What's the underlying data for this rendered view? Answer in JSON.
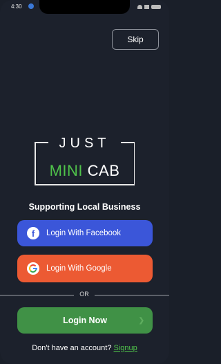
{
  "status": {
    "time": "4:30"
  },
  "header": {
    "skip_label": "Skip"
  },
  "logo": {
    "top": "JUST",
    "mini": "MINI",
    "cab": "CAB"
  },
  "tagline": "Supporting Local Business",
  "auth": {
    "facebook_label": "Login With Facebook",
    "google_label": "Login With Google",
    "or_label": "OR",
    "login_label": "Login Now"
  },
  "footer": {
    "prompt": "Don't have an account?",
    "signup_label": "Signup"
  },
  "icons": {
    "facebook": "facebook-icon",
    "google": "google-icon",
    "location": "location-arrow-icon",
    "wifi": "wifi-icon",
    "signal": "signal-icon",
    "battery": "battery-icon",
    "chevron": "chevron-right-icon"
  },
  "colors": {
    "background": "#1c212c",
    "facebook": "#3b56d9",
    "google": "#ec5a33",
    "login": "#409146",
    "accent_green": "#4fc24a"
  }
}
